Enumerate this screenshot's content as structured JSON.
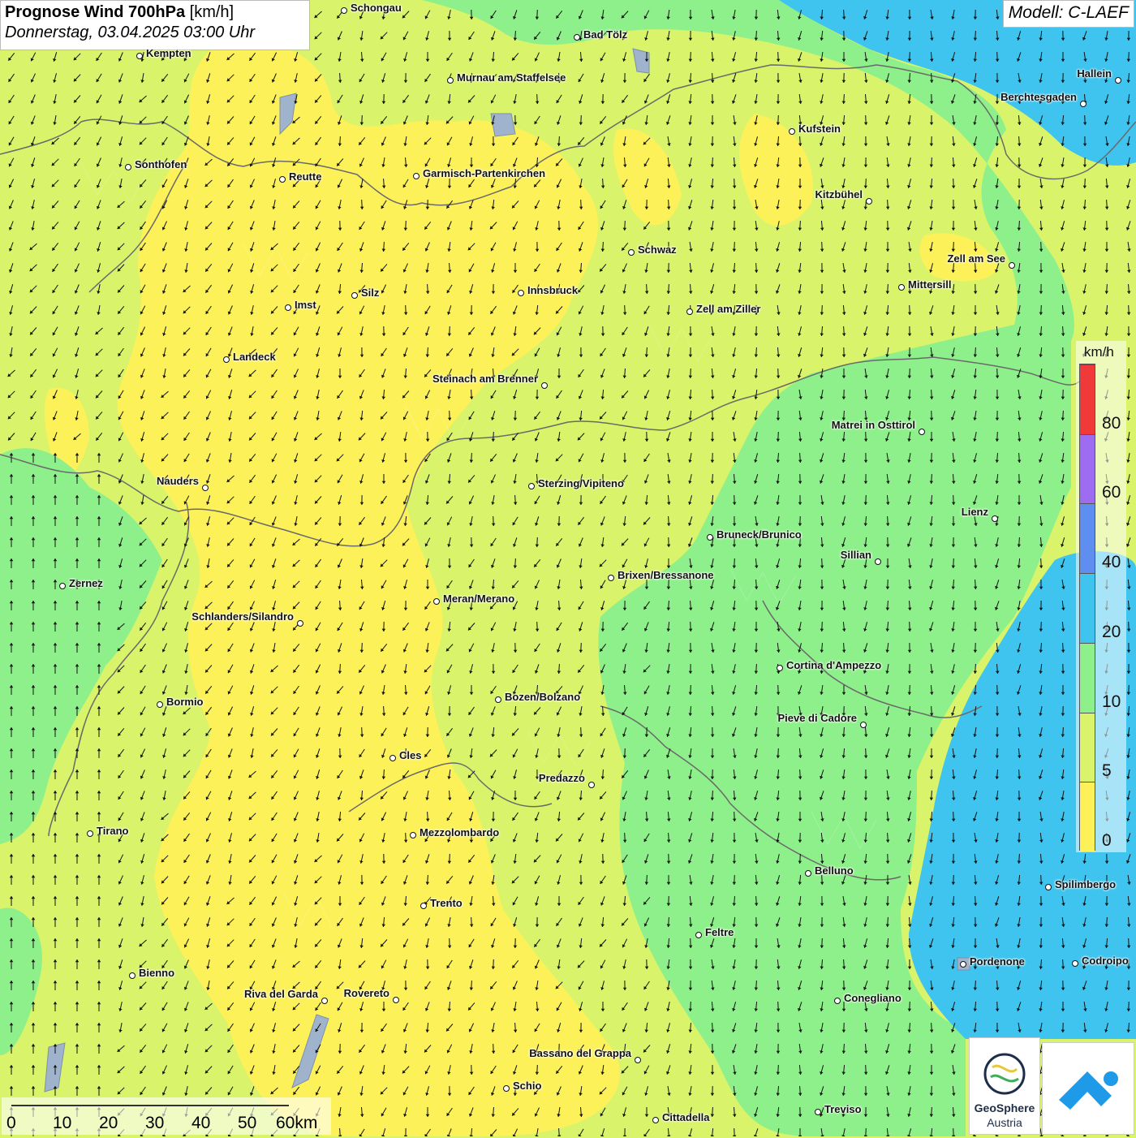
{
  "header": {
    "title_bold": "Prognose Wind 700hPa",
    "title_unit": "[km/h]",
    "subtitle": "Donnerstag, 03.04.2025 03:00 Uhr",
    "model": "Modell: C-LAEF"
  },
  "legend": {
    "unit": "km/h",
    "labels": [
      "0",
      "5",
      "10",
      "20",
      "40",
      "60",
      "80"
    ],
    "colors": [
      "#fdf15a",
      "#d9f36a",
      "#8ef08a",
      "#3ec4ee",
      "#5e8ff0",
      "#9d6cf0",
      "#f03a3a"
    ]
  },
  "scalebar": {
    "labels": [
      "0",
      "10",
      "20",
      "30",
      "40",
      "50",
      "60km"
    ]
  },
  "logos": {
    "geosphere_line1": "GeoSphere",
    "geosphere_line2": "Austria"
  },
  "cities": [
    {
      "name": "Schongau"
    },
    {
      "name": "Bad Tölz"
    },
    {
      "name": "Kempten"
    },
    {
      "name": "Murnau am Staffelsee"
    },
    {
      "name": "Hallein"
    },
    {
      "name": "Berchtesgaden"
    },
    {
      "name": "Kufstein"
    },
    {
      "name": "Sonthofen"
    },
    {
      "name": "Reutte"
    },
    {
      "name": "Garmisch-Partenkirchen"
    },
    {
      "name": "Kitzbühel"
    },
    {
      "name": "Schwaz"
    },
    {
      "name": "Zell am See"
    },
    {
      "name": "Mittersill"
    },
    {
      "name": "Innsbruck"
    },
    {
      "name": "Silz"
    },
    {
      "name": "Imst"
    },
    {
      "name": "Zell am Ziller"
    },
    {
      "name": "Landeck"
    },
    {
      "name": "Steinach am Brenner"
    },
    {
      "name": "Matrei in Osttirol"
    },
    {
      "name": "Nauders"
    },
    {
      "name": "Sterzing/Vipiteno"
    },
    {
      "name": "Lienz"
    },
    {
      "name": "Bruneck/Brunico"
    },
    {
      "name": "Sillian"
    },
    {
      "name": "Brixen/Bressanone"
    },
    {
      "name": "Zernez"
    },
    {
      "name": "Meran/Merano"
    },
    {
      "name": "Schlanders/Silandro"
    },
    {
      "name": "Cortina d'Ampezzo"
    },
    {
      "name": "Bozen/Bolzano"
    },
    {
      "name": "Bormio"
    },
    {
      "name": "Pieve di Cadore"
    },
    {
      "name": "Cles"
    },
    {
      "name": "Predazzo"
    },
    {
      "name": "Tirano"
    },
    {
      "name": "Mezzolombardo"
    },
    {
      "name": "Belluno"
    },
    {
      "name": "Spilimbergo"
    },
    {
      "name": "Trento"
    },
    {
      "name": "Feltre"
    },
    {
      "name": "Pordenone"
    },
    {
      "name": "Codroipo"
    },
    {
      "name": "Bienno"
    },
    {
      "name": "Riva del Garda"
    },
    {
      "name": "Rovereto"
    },
    {
      "name": "Conegliano"
    },
    {
      "name": "Bassano del Grappa"
    },
    {
      "name": "Schio"
    },
    {
      "name": "Treviso"
    },
    {
      "name": "Cittadella"
    }
  ]
}
